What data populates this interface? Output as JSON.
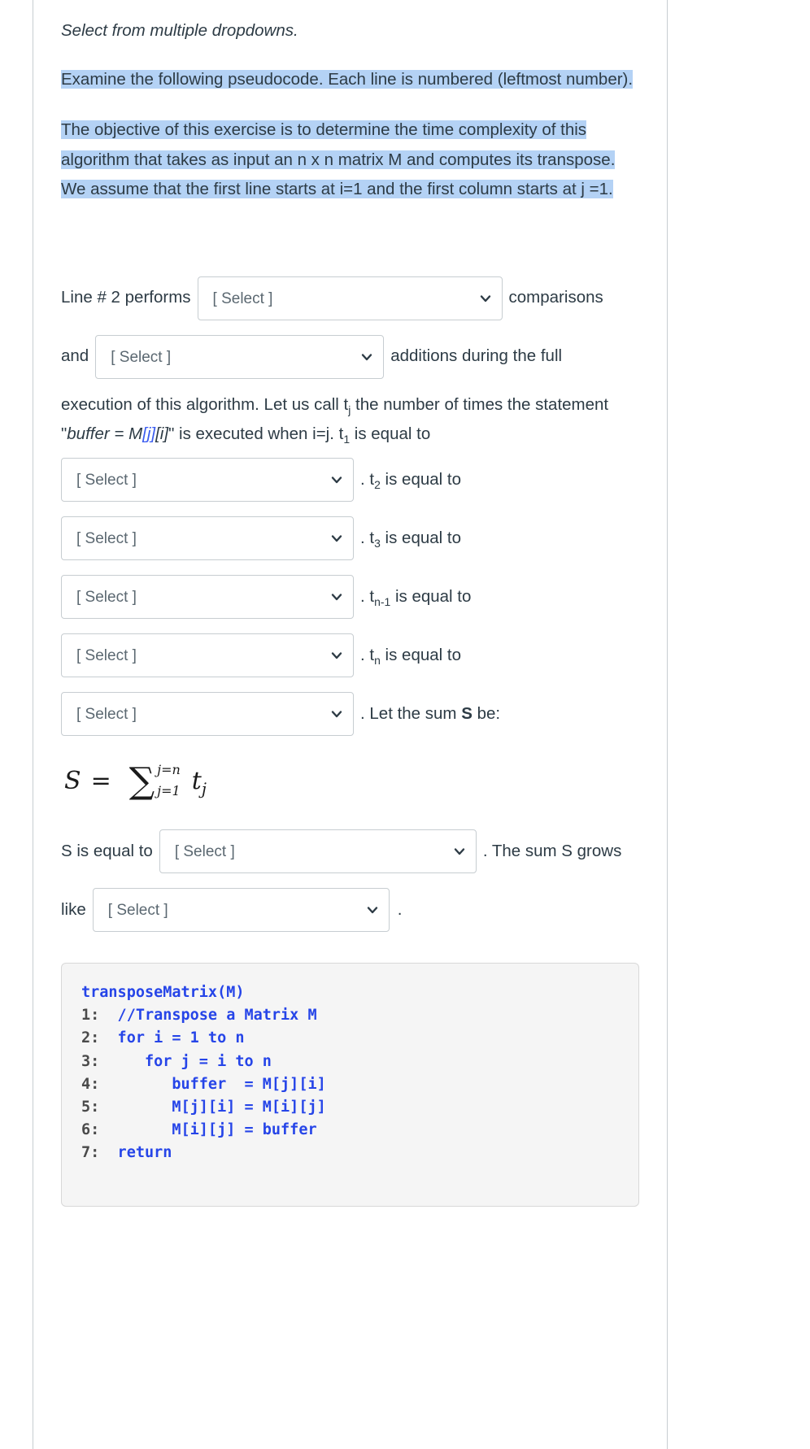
{
  "instruction": "Select from multiple dropdowns.",
  "paragraphs": {
    "p1": "Examine the following pseudocode. Each line is numbered (leftmost number).",
    "p2": "The objective of this exercise is to determine the time complexity of this algorithm that takes as input an n x n matrix M  and computes its transpose. We assume that the first line starts at i=1 and the first column starts at j =1."
  },
  "select_placeholder": "[ Select ]",
  "chevron_icon": "chevron-down-icon",
  "line2": {
    "prefix": "Line # 2 performs",
    "after_first": "comparisons",
    "and": "and",
    "after_second": "additions during the full"
  },
  "tj_sentence": {
    "part1": "execution of this algorithm. Let us call t",
    "sub1": "j",
    "part2": " the number of times the statement \"",
    "code_buffer": "buffer",
    "code_eq": " = ",
    "code_M": "M",
    "code_j": "[j]",
    "code_i": "[i]",
    "part3": "\" is executed when i=j. t",
    "sub2": "1",
    "part4": " is equal to"
  },
  "t_rows": [
    {
      "label_prefix": ". t",
      "label_sub": "2",
      "label_suffix": " is equal to"
    },
    {
      "label_prefix": ". t",
      "label_sub": "3",
      "label_suffix": " is equal to"
    },
    {
      "label_prefix": ". t",
      "label_sub": "n-1",
      "label_suffix": " is equal to"
    },
    {
      "label_prefix": ". t",
      "label_sub": "n",
      "label_suffix": " is equal to"
    },
    {
      "label_prefix": ". Let the sum ",
      "label_bold": "S",
      "label_suffix": " be:"
    }
  ],
  "formula": {
    "lhs": "S",
    "eq": "=",
    "sigma": "∑",
    "upper": "j=n",
    "lower": "j=1",
    "term": "t",
    "term_sub": "j",
    "latex": "S = \\sum_{j=1}^{j=n} t_j"
  },
  "sum_row": {
    "prefix": "S is equal to",
    "after": ". The sum S grows",
    "like": "like",
    "period": "."
  },
  "code": {
    "title": "transposeMatrix(M)",
    "lines": [
      {
        "n": "1:",
        "text": "  //Transpose a Matrix M"
      },
      {
        "n": "2:",
        "text": "  for i = 1 to n"
      },
      {
        "n": "3:",
        "text": "     for j = i to n"
      },
      {
        "n": "4:",
        "text": "        buffer  = M[j][i]"
      },
      {
        "n": "5:",
        "text": "        M[j][i] = M[i][j]"
      },
      {
        "n": "6:",
        "text": "        M[i][j] = buffer"
      },
      {
        "n": "7:",
        "text": "  return"
      }
    ]
  },
  "colors": {
    "highlight": "#b4d2f5",
    "code_blue": "#2645e8",
    "inline_blue": "#3a5cf0",
    "border": "#c7cdd1",
    "code_bg": "#f5f5f5"
  }
}
